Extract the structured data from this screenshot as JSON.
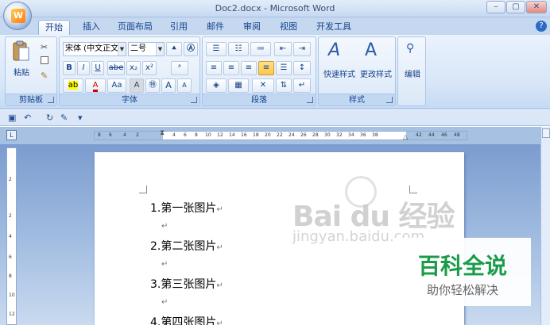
{
  "window": {
    "title": "Doc2.docx - Microsoft Word",
    "minimize": "–",
    "restore": "▢",
    "office_logo": "W"
  },
  "tabs": [
    {
      "label": "开始",
      "active": true
    },
    {
      "label": "插入"
    },
    {
      "label": "页面布局"
    },
    {
      "label": "引用"
    },
    {
      "label": "邮件"
    },
    {
      "label": "审阅"
    },
    {
      "label": "视图"
    },
    {
      "label": "开发工具"
    }
  ],
  "help": "?",
  "ribbon": {
    "clipboard": {
      "label": "剪贴板",
      "paste": "粘贴"
    },
    "font": {
      "label": "字体",
      "font_name": "宋体 (中文正文",
      "font_size": "二号",
      "bold": "B",
      "italic": "I",
      "underline": "U",
      "strike": "abe",
      "sub": "x₂",
      "sup": "x²",
      "change_case": "Aa",
      "grow": "A",
      "shrink": "A"
    },
    "paragraph": {
      "label": "段落"
    },
    "styles": {
      "label": "样式",
      "quick_styles": "快速样式",
      "change_styles": "更改样式"
    },
    "editing": {
      "label": "编辑"
    }
  },
  "ruler": {
    "left_ticks": [
      "8",
      "6",
      "4",
      "2"
    ],
    "right_ticks": [
      "4",
      "6",
      "8",
      "10",
      "12",
      "14",
      "16",
      "18",
      "20",
      "22",
      "24",
      "26",
      "28",
      "30",
      "32",
      "34",
      "36",
      "38",
      "42",
      "44",
      "46",
      "48"
    ],
    "v_ticks": [
      "2",
      "2",
      "4",
      "6",
      "8",
      "10",
      "12"
    ]
  },
  "document": {
    "items": [
      "1.第一张图片",
      "2.第二张图片",
      "3.第三张图片",
      "4.第四张图片"
    ],
    "para_mark": "↵"
  },
  "watermark": {
    "brand": "Bai du 经验",
    "url": "jingyan.baidu.com"
  },
  "overlay": {
    "title": "百科全说",
    "subtitle": "助你轻松解决"
  },
  "colors": {
    "accent": "#15428b",
    "overlay_green": "#1a9b47"
  }
}
